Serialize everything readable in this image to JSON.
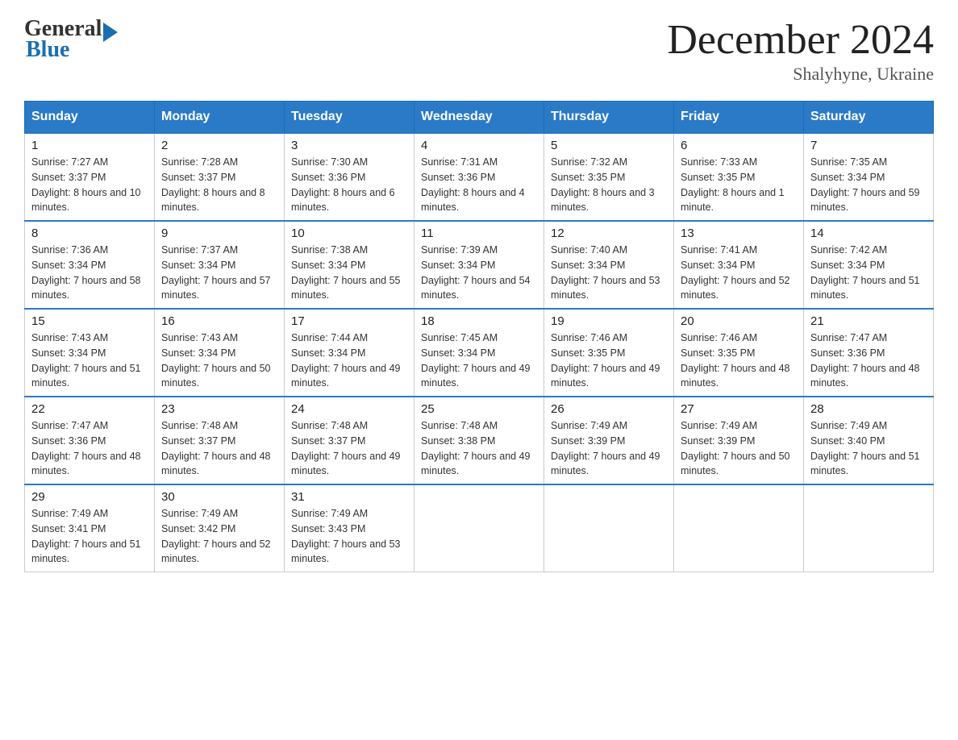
{
  "logo": {
    "text_general": "General",
    "text_blue": "Blue"
  },
  "header": {
    "month_year": "December 2024",
    "location": "Shalyhyne, Ukraine"
  },
  "days_of_week": [
    "Sunday",
    "Monday",
    "Tuesday",
    "Wednesday",
    "Thursday",
    "Friday",
    "Saturday"
  ],
  "weeks": [
    [
      {
        "day": "1",
        "sunrise": "7:27 AM",
        "sunset": "3:37 PM",
        "daylight": "8 hours and 10 minutes."
      },
      {
        "day": "2",
        "sunrise": "7:28 AM",
        "sunset": "3:37 PM",
        "daylight": "8 hours and 8 minutes."
      },
      {
        "day": "3",
        "sunrise": "7:30 AM",
        "sunset": "3:36 PM",
        "daylight": "8 hours and 6 minutes."
      },
      {
        "day": "4",
        "sunrise": "7:31 AM",
        "sunset": "3:36 PM",
        "daylight": "8 hours and 4 minutes."
      },
      {
        "day": "5",
        "sunrise": "7:32 AM",
        "sunset": "3:35 PM",
        "daylight": "8 hours and 3 minutes."
      },
      {
        "day": "6",
        "sunrise": "7:33 AM",
        "sunset": "3:35 PM",
        "daylight": "8 hours and 1 minute."
      },
      {
        "day": "7",
        "sunrise": "7:35 AM",
        "sunset": "3:34 PM",
        "daylight": "7 hours and 59 minutes."
      }
    ],
    [
      {
        "day": "8",
        "sunrise": "7:36 AM",
        "sunset": "3:34 PM",
        "daylight": "7 hours and 58 minutes."
      },
      {
        "day": "9",
        "sunrise": "7:37 AM",
        "sunset": "3:34 PM",
        "daylight": "7 hours and 57 minutes."
      },
      {
        "day": "10",
        "sunrise": "7:38 AM",
        "sunset": "3:34 PM",
        "daylight": "7 hours and 55 minutes."
      },
      {
        "day": "11",
        "sunrise": "7:39 AM",
        "sunset": "3:34 PM",
        "daylight": "7 hours and 54 minutes."
      },
      {
        "day": "12",
        "sunrise": "7:40 AM",
        "sunset": "3:34 PM",
        "daylight": "7 hours and 53 minutes."
      },
      {
        "day": "13",
        "sunrise": "7:41 AM",
        "sunset": "3:34 PM",
        "daylight": "7 hours and 52 minutes."
      },
      {
        "day": "14",
        "sunrise": "7:42 AM",
        "sunset": "3:34 PM",
        "daylight": "7 hours and 51 minutes."
      }
    ],
    [
      {
        "day": "15",
        "sunrise": "7:43 AM",
        "sunset": "3:34 PM",
        "daylight": "7 hours and 51 minutes."
      },
      {
        "day": "16",
        "sunrise": "7:43 AM",
        "sunset": "3:34 PM",
        "daylight": "7 hours and 50 minutes."
      },
      {
        "day": "17",
        "sunrise": "7:44 AM",
        "sunset": "3:34 PM",
        "daylight": "7 hours and 49 minutes."
      },
      {
        "day": "18",
        "sunrise": "7:45 AM",
        "sunset": "3:34 PM",
        "daylight": "7 hours and 49 minutes."
      },
      {
        "day": "19",
        "sunrise": "7:46 AM",
        "sunset": "3:35 PM",
        "daylight": "7 hours and 49 minutes."
      },
      {
        "day": "20",
        "sunrise": "7:46 AM",
        "sunset": "3:35 PM",
        "daylight": "7 hours and 48 minutes."
      },
      {
        "day": "21",
        "sunrise": "7:47 AM",
        "sunset": "3:36 PM",
        "daylight": "7 hours and 48 minutes."
      }
    ],
    [
      {
        "day": "22",
        "sunrise": "7:47 AM",
        "sunset": "3:36 PM",
        "daylight": "7 hours and 48 minutes."
      },
      {
        "day": "23",
        "sunrise": "7:48 AM",
        "sunset": "3:37 PM",
        "daylight": "7 hours and 48 minutes."
      },
      {
        "day": "24",
        "sunrise": "7:48 AM",
        "sunset": "3:37 PM",
        "daylight": "7 hours and 49 minutes."
      },
      {
        "day": "25",
        "sunrise": "7:48 AM",
        "sunset": "3:38 PM",
        "daylight": "7 hours and 49 minutes."
      },
      {
        "day": "26",
        "sunrise": "7:49 AM",
        "sunset": "3:39 PM",
        "daylight": "7 hours and 49 minutes."
      },
      {
        "day": "27",
        "sunrise": "7:49 AM",
        "sunset": "3:39 PM",
        "daylight": "7 hours and 50 minutes."
      },
      {
        "day": "28",
        "sunrise": "7:49 AM",
        "sunset": "3:40 PM",
        "daylight": "7 hours and 51 minutes."
      }
    ],
    [
      {
        "day": "29",
        "sunrise": "7:49 AM",
        "sunset": "3:41 PM",
        "daylight": "7 hours and 51 minutes."
      },
      {
        "day": "30",
        "sunrise": "7:49 AM",
        "sunset": "3:42 PM",
        "daylight": "7 hours and 52 minutes."
      },
      {
        "day": "31",
        "sunrise": "7:49 AM",
        "sunset": "3:43 PM",
        "daylight": "7 hours and 53 minutes."
      },
      null,
      null,
      null,
      null
    ]
  ],
  "labels": {
    "sunrise": "Sunrise:",
    "sunset": "Sunset:",
    "daylight": "Daylight:"
  }
}
